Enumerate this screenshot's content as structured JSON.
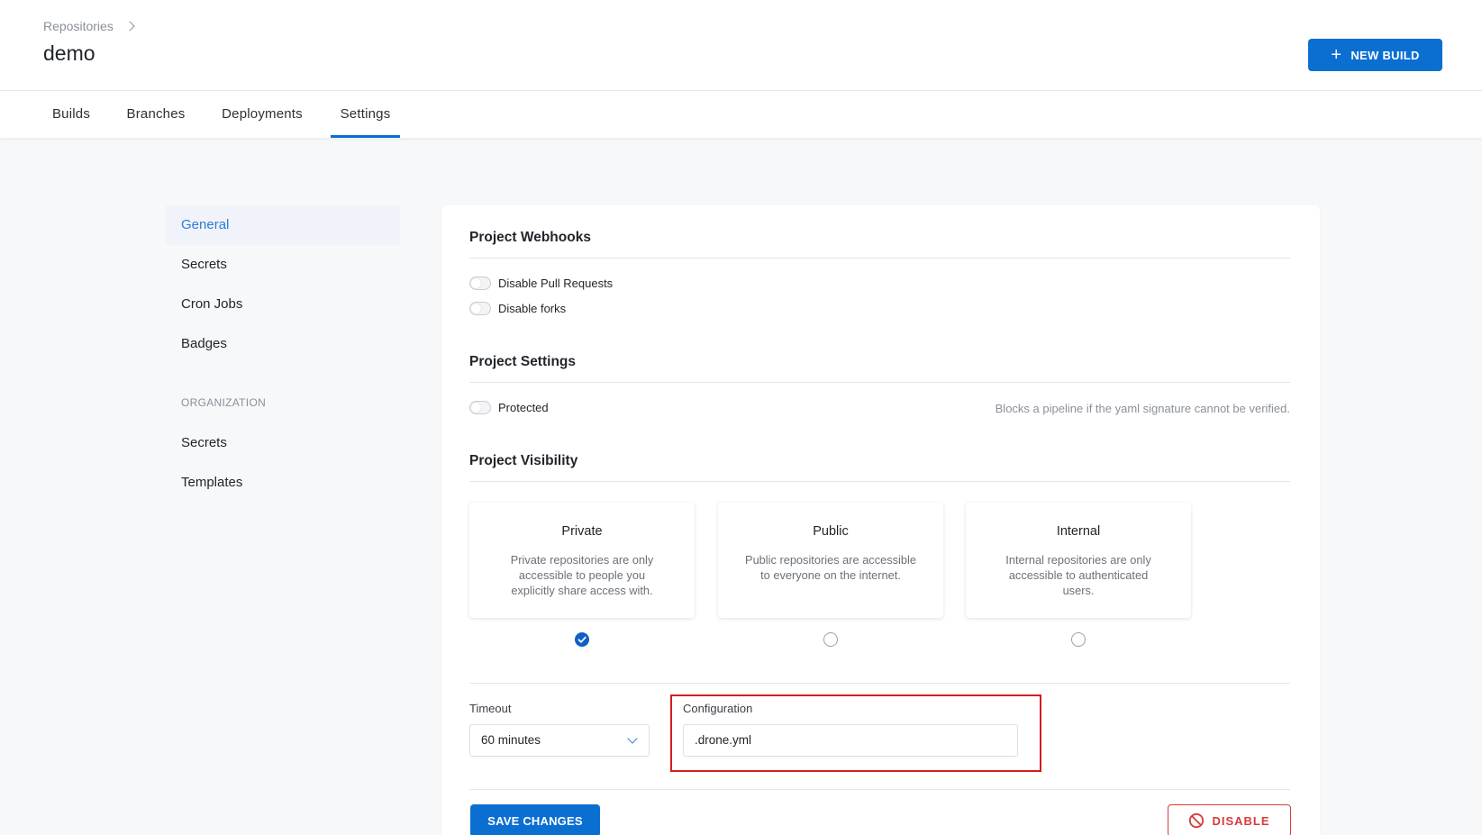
{
  "header": {
    "breadcrumb": "Repositories",
    "title": "demo",
    "new_build_label": "NEW BUILD"
  },
  "tabs": [
    {
      "label": "Builds"
    },
    {
      "label": "Branches"
    },
    {
      "label": "Deployments"
    },
    {
      "label": "Settings",
      "active": true
    }
  ],
  "sidebar": {
    "items": [
      {
        "label": "General",
        "active": true
      },
      {
        "label": "Secrets"
      },
      {
        "label": "Cron Jobs"
      },
      {
        "label": "Badges"
      }
    ],
    "org_heading": "ORGANIZATION",
    "org_items": [
      {
        "label": "Secrets"
      },
      {
        "label": "Templates"
      }
    ]
  },
  "webhooks": {
    "title": "Project Webhooks",
    "disable_pull_requests": {
      "label": "Disable Pull Requests",
      "on": false
    },
    "disable_forks": {
      "label": "Disable forks",
      "on": false
    }
  },
  "settings": {
    "title": "Project Settings",
    "protected": {
      "label": "Protected",
      "on": false
    },
    "protected_hint": "Blocks a pipeline if the yaml signature cannot be verified."
  },
  "visibility": {
    "title": "Project Visibility",
    "selected": "Private",
    "options": [
      {
        "title": "Private",
        "desc": "Private repositories are only accessible to people you explicitly share access with."
      },
      {
        "title": "Public",
        "desc": "Public repositories are accessible to everyone on the internet."
      },
      {
        "title": "Internal",
        "desc": "Internal repositories are only accessible to authenticated users."
      }
    ]
  },
  "timeout": {
    "label": "Timeout",
    "value": "60 minutes"
  },
  "configuration": {
    "label": "Configuration",
    "value": ".drone.yml"
  },
  "actions": {
    "save_label": "SAVE CHANGES",
    "disable_label": "DISABLE"
  },
  "colors": {
    "primary": "#0b6fd1",
    "danger": "#d63a3a",
    "highlight": "#d11f1f"
  }
}
